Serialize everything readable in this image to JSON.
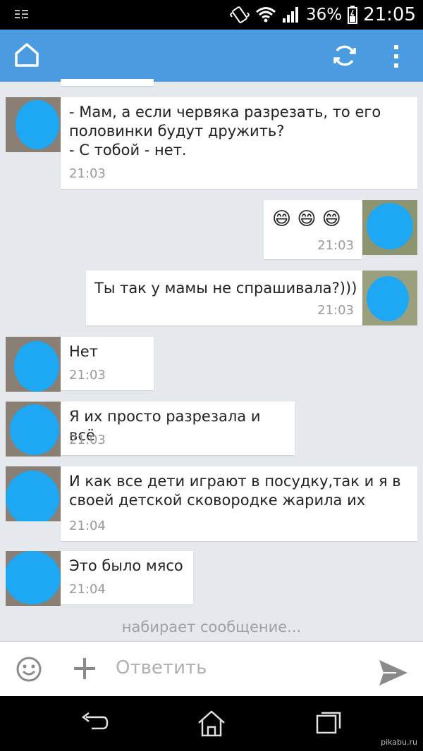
{
  "status_bar": {
    "battery": "36%",
    "time": "21:05",
    "icons": [
      "notification-icon",
      "vibrate-icon",
      "wifi-icon",
      "signal-icon",
      "battery-icon"
    ]
  },
  "app_bar": {
    "icons": [
      "home-icon",
      "refresh-icon",
      "overflow-menu-icon"
    ],
    "color": "#4a9be0"
  },
  "messages": [
    {
      "direction": "in",
      "text": "- Мам, а если червяка разрезать, то его\nполовинки будут дружить?\n- С тобой - нет.",
      "time": "21:03"
    },
    {
      "direction": "out",
      "text": "😄 😄 😄",
      "time": "21:03"
    },
    {
      "direction": "out",
      "text": "Ты так у мамы не спрашивала?)))",
      "time": "21:03"
    },
    {
      "direction": "in",
      "text": "Нет",
      "time": "21:03"
    },
    {
      "direction": "in",
      "text": "Я их просто разрезала и всё",
      "time": "21:03"
    },
    {
      "direction": "in",
      "text": "И как все дети играют в посудку,так и я в\nсвоей детской сковородке жарила их",
      "time": "21:04"
    },
    {
      "direction": "in",
      "text": "Это было мясо",
      "time": "21:04"
    }
  ],
  "typing_indicator": "набирает сообщение...",
  "composer": {
    "placeholder": "Ответить",
    "icons": [
      "emoji-icon",
      "plus-icon",
      "send-icon"
    ]
  },
  "nav_bar": {
    "icons": [
      "back-icon",
      "home-nav-icon",
      "recents-icon"
    ]
  },
  "watermark": "pikabu.ru"
}
